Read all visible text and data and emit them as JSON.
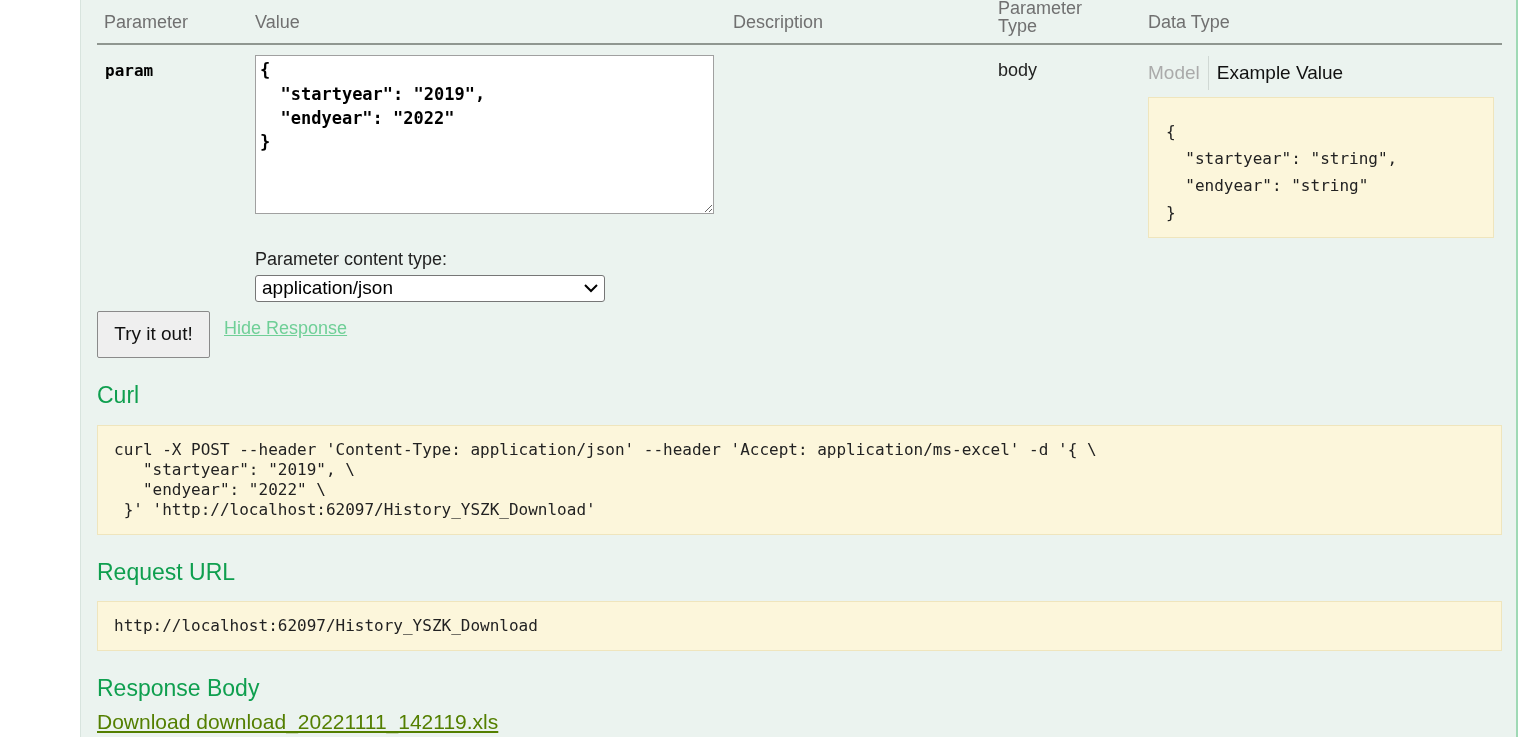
{
  "table": {
    "columns": [
      "Parameter",
      "Value",
      "Description",
      "Parameter\nType",
      "Data Type"
    ],
    "rows": [
      {
        "name": "param",
        "value": "{\n  \"startyear\": \"2019\",\n  \"endyear\": \"2022\"\n}",
        "parameter_type": "body",
        "data_type_tabs": [
          {
            "label": "Model",
            "selected": false
          },
          {
            "label": "Example Value",
            "selected": true
          }
        ],
        "example_value": "{\n  \"startyear\": \"string\",\n  \"endyear\": \"string\"\n}",
        "content_type_label": "Parameter content type:",
        "content_type": "application/json"
      }
    ]
  },
  "try_button": "Try it out!",
  "hide_response_link": "Hide Response",
  "sections": [
    {
      "title": "Curl",
      "kind": "code",
      "text": "curl -X POST --header 'Content-Type: application/json' --header 'Accept: application/ms-excel' -d '{ \\\n   \"startyear\": \"2019\", \\\n   \"endyear\": \"2022\" \\\n }' 'http://localhost:62097/History_YSZK_Download'"
    },
    {
      "title": "Request URL",
      "kind": "code",
      "text": "http://localhost:62097/History_YSZK_Download"
    },
    {
      "title": "Response Body",
      "kind": "link",
      "text": "Download download_20221111_142119.xls"
    }
  ]
}
